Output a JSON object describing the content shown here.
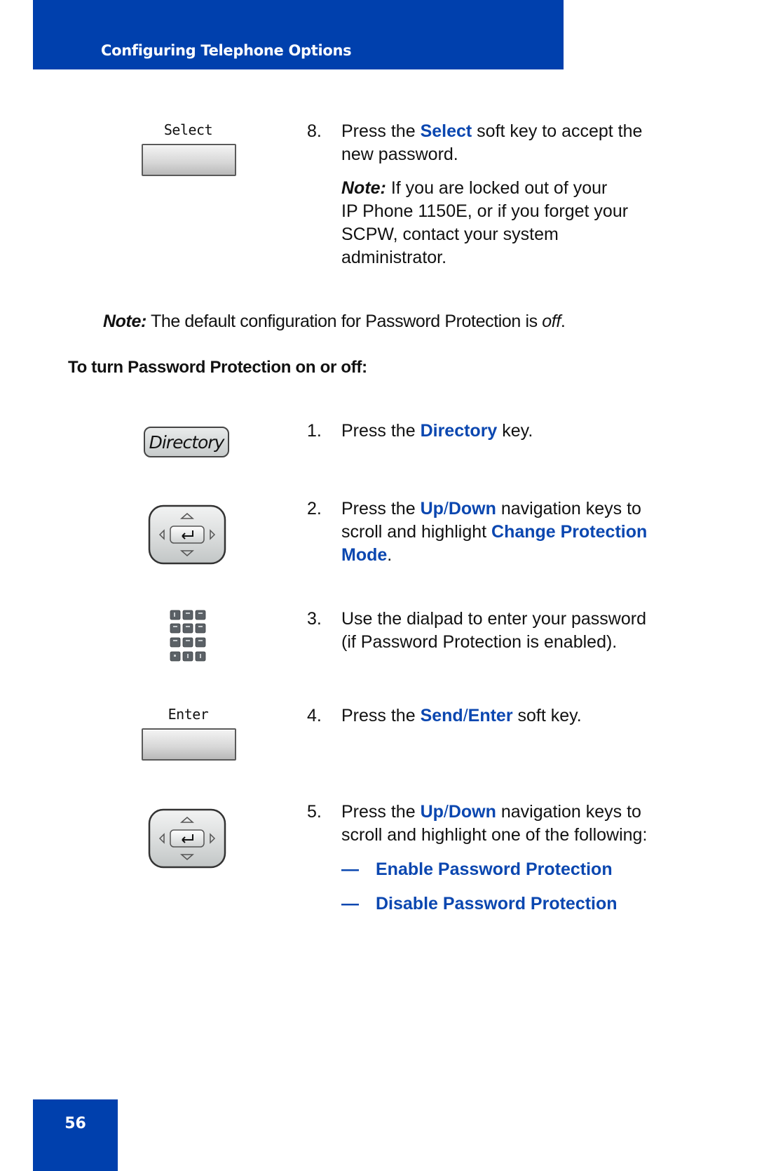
{
  "header": {
    "section_title": "Configuring Telephone Options"
  },
  "page_number": "56",
  "colors": {
    "brand_blue": "#0040ad",
    "link_blue": "#0b47b0"
  },
  "step8": {
    "number": "8.",
    "pre": "Press the ",
    "key": "Select",
    "post": " soft key to accept the",
    "line2": "new password.",
    "note_label": "Note:",
    "note_line1": " If you are locked out of your",
    "note_line2": "IP Phone 1150E, or if you forget your",
    "note_line3": "SCPW, contact your system",
    "note_line4": "administrator.",
    "softkey_label": "Select"
  },
  "default_note": {
    "label": "Note:",
    "text": " The default configuration for Password Protection is ",
    "value": "off",
    "end": "."
  },
  "procedure_heading": "To turn Password Protection on or off:",
  "steps": [
    {
      "number": "1.",
      "pre": "Press the ",
      "key": "Directory",
      "post": " key.",
      "icon": "directory-key-icon",
      "icon_label": "Directory"
    },
    {
      "number": "2.",
      "pre": "Press the ",
      "key_a": "Up",
      "sep": "/",
      "key_b": "Down",
      "post": " navigation keys to",
      "line2_pre": "scroll and highlight ",
      "line2_key": "Change Protection",
      "line3_key": "Mode",
      "line3_end": ".",
      "icon": "navigation-cluster-icon"
    },
    {
      "number": "3.",
      "line1": "Use the dialpad to enter your password",
      "line2": "(if Password Protection is enabled).",
      "icon": "dialpad-icon"
    },
    {
      "number": "4.",
      "pre": "Press the ",
      "key_a": "Send",
      "sep": "/",
      "key_b": "Enter",
      "post": " soft key.",
      "icon": "softkey-icon",
      "softkey_label": "Enter"
    },
    {
      "number": "5.",
      "pre": "Press the ",
      "key_a": "Up",
      "sep": "/",
      "key_b": "Down",
      "post": " navigation keys to",
      "line2": "scroll and highlight one of the following:",
      "icon": "navigation-cluster-icon",
      "options": [
        {
          "dash": "—",
          "label": "Enable Password Protection"
        },
        {
          "dash": "—",
          "label": "Disable Password Protection"
        }
      ]
    }
  ]
}
